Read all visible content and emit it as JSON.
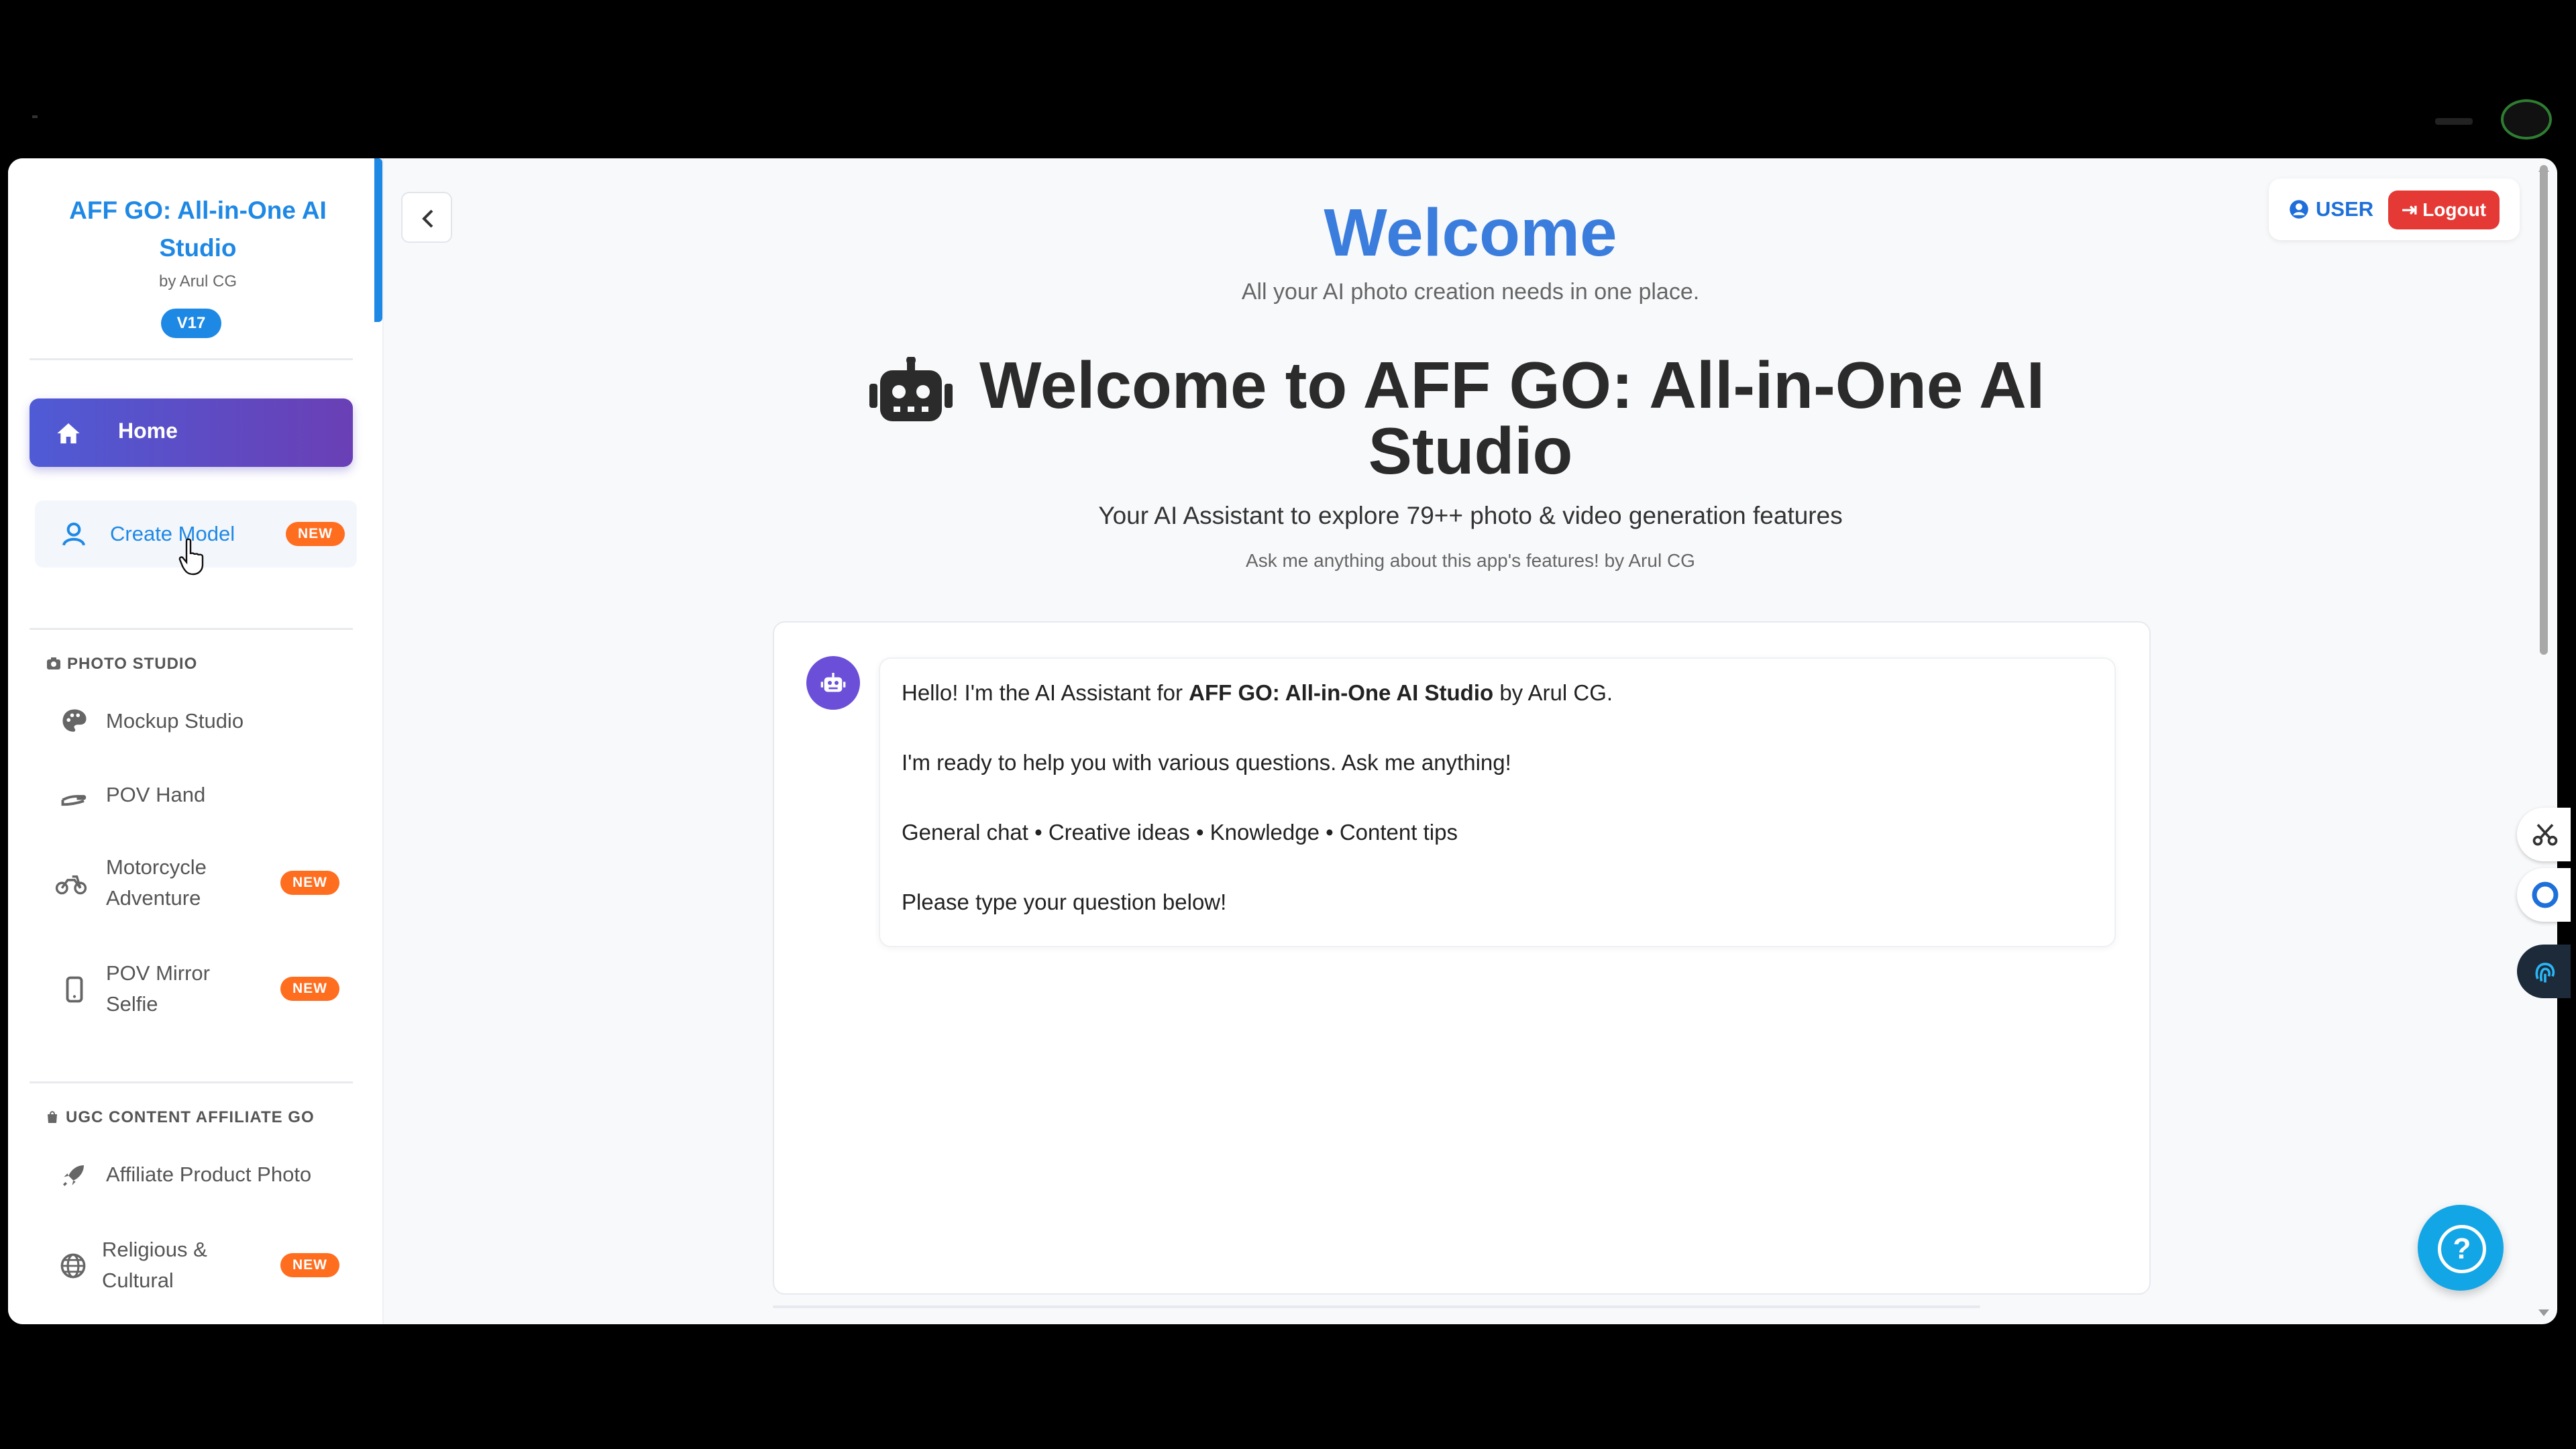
{
  "sidebar": {
    "brand_title": "AFF GO: All-in-One AI Studio",
    "brand_by": "by Arul CG",
    "version": "V17",
    "home_label": "Home",
    "create_model": {
      "label": "Create Model",
      "badge": "NEW"
    },
    "sections": [
      {
        "title": "PHOTO STUDIO",
        "icon": "camera-icon",
        "items": [
          {
            "label": "Mockup Studio",
            "icon": "palette-icon"
          },
          {
            "label": "POV Hand",
            "icon": "hand-icon"
          },
          {
            "label": "Motorcycle Adventure",
            "icon": "motorcycle-icon",
            "badge": "NEW"
          },
          {
            "label": "POV Mirror Selfie",
            "icon": "phone-icon",
            "badge": "NEW"
          }
        ]
      },
      {
        "title": "UGC CONTENT AFFILIATE GO",
        "icon": "bag-icon",
        "items": [
          {
            "label": "Affiliate Product Photo",
            "icon": "rocket-icon"
          },
          {
            "label": "Religious & Cultural",
            "icon": "globe-icon",
            "badge": "NEW"
          }
        ]
      }
    ]
  },
  "header": {
    "user_label": "USER",
    "logout_label": "Logout"
  },
  "main": {
    "welcome_title": "Welcome",
    "welcome_sub": "All your AI photo creation needs in one place.",
    "hero_line1": "Welcome to AFF GO: All-in-One AI",
    "hero_line2": "Studio",
    "hero_desc": "Your AI Assistant to explore 79++ photo & video generation features",
    "hero_note": "Ask me anything about this app's features! by Arul CG"
  },
  "chat": {
    "greeting_prefix": "Hello! I'm the AI Assistant for ",
    "greeting_bold": "AFF GO: All-in-One AI Studio",
    "greeting_suffix": " by Arul CG.",
    "line2": "I'm ready to help you with various questions. Ask me anything!",
    "line3": "General chat • Creative ideas • Knowledge • Content tips",
    "line4": "Please type your question below!"
  },
  "help_label": "?",
  "colors": {
    "accent": "#1e88e5",
    "home_gradient_start": "#4f5bd5",
    "home_gradient_end": "#6a3fb5",
    "badge_new": "#ff6d1f",
    "logout": "#e53935",
    "help": "#12a6e6"
  }
}
